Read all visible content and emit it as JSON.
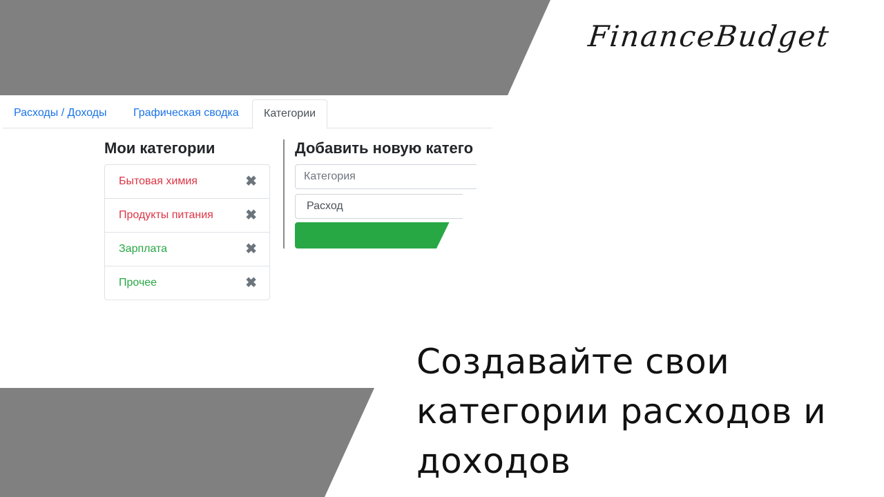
{
  "brand": "FinanceBudget",
  "tagline": [
    "Создавайте свои",
    "категории расходов и",
    "доходов"
  ],
  "tabs": [
    {
      "label": "Расходы / Доходы"
    },
    {
      "label": "Графическая сводка"
    },
    {
      "label": "Категории"
    }
  ],
  "my_categories": {
    "title": "Мои категории",
    "items": [
      {
        "name": "Бытовая химия",
        "type": "expense",
        "color": "#dc3545"
      },
      {
        "name": "Продукты питания",
        "type": "expense",
        "color": "#dc3545"
      },
      {
        "name": "Зарплата",
        "type": "income",
        "color": "#28a745"
      },
      {
        "name": "Прочее",
        "type": "income",
        "color": "#28a745"
      }
    ],
    "delete_glyph": "✖"
  },
  "add_category": {
    "title": "Добавить новую катего",
    "input_placeholder": "Категория",
    "select_value": "Расход"
  },
  "colors": {
    "accent": "#1a73e8",
    "expense": "#dc3545",
    "income": "#28a745",
    "panel_gray": "#808080"
  }
}
